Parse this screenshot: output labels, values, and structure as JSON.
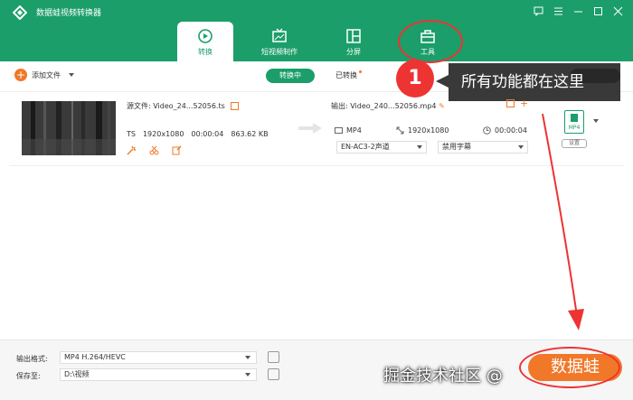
{
  "app": {
    "title": "数据蛙视频转换器"
  },
  "tabs": [
    {
      "label": "转换",
      "icon": "convert-icon"
    },
    {
      "label": "短视频制作",
      "icon": "tv-icon"
    },
    {
      "label": "分屏",
      "icon": "split-icon"
    },
    {
      "label": "工具",
      "icon": "toolbox-icon"
    }
  ],
  "toolbar": {
    "add_label": "添加文件",
    "converting": "转换中",
    "converted": "已转换"
  },
  "callout": {
    "number": "1",
    "text": "所有功能都在这里"
  },
  "file": {
    "source_label": "源文件:",
    "source_name": "Video_24...52056.ts",
    "format": "TS",
    "resolution": "1920x1080",
    "duration": "00:00:04",
    "size": "863.62 KB",
    "output_label": "输出:",
    "output_name": "Video_240...52056.mp4",
    "out_format": "MP4",
    "out_resolution": "1920x1080",
    "out_duration": "00:00:04",
    "audio": "EN-AC3-2声道",
    "subtitle": "禁用字幕",
    "format_badge": "MP4",
    "settings": "设置"
  },
  "bottom": {
    "output_format_label": "输出格式:",
    "output_format": "MP4 H.264/HEVC",
    "save_to_label": "保存至:",
    "save_to": "D:\\视频"
  },
  "convert_button": "数据蛙",
  "watermark": "掘金技术社区 @",
  "colors": {
    "brand": "#1b9e6a",
    "accent": "#f07828",
    "highlight": "#e33333"
  }
}
